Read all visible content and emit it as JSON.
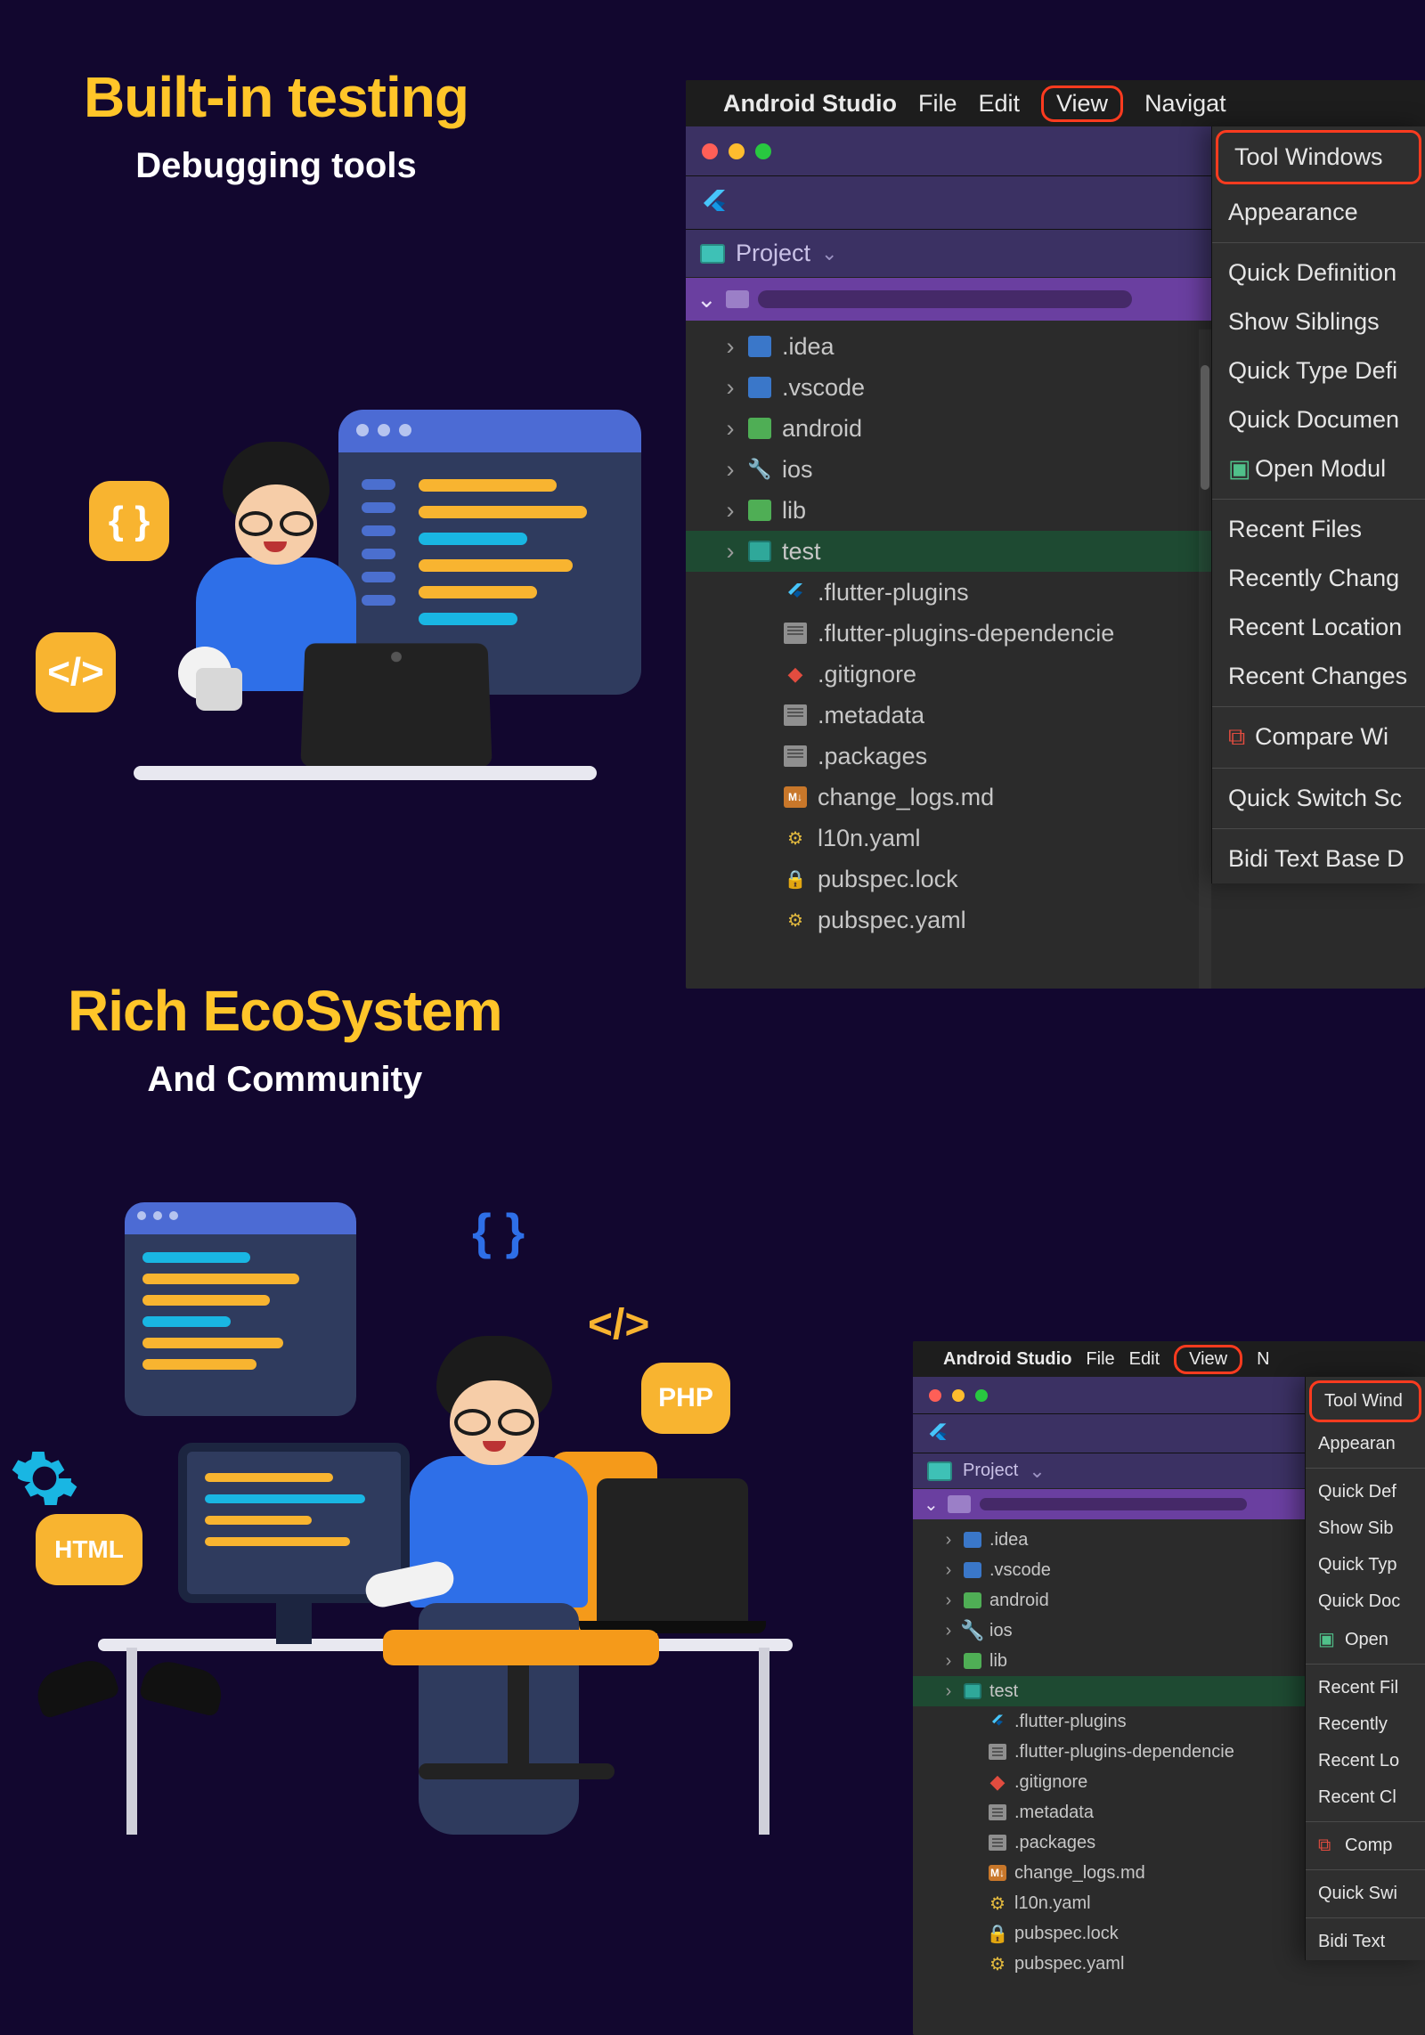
{
  "sections": {
    "builtIn": {
      "title": "Built-in testing",
      "subtitle": "Debugging tools"
    },
    "ecosystem": {
      "title": "Rich EcoSystem",
      "subtitle": "And Community"
    }
  },
  "illus2": {
    "chip_html": "HTML",
    "chip_php": "PHP",
    "braces": "{ }",
    "angles": "</>"
  },
  "illus1": {
    "chip1": "{ }",
    "chip2": "</>"
  },
  "studio": {
    "menubar": {
      "app": "Android Studio",
      "items": [
        "File",
        "Edit",
        "View",
        "Navigat",
        "N"
      ]
    },
    "project_label": "Project",
    "tree": [
      {
        "name": ".idea",
        "icon": "folder blue",
        "caret": true
      },
      {
        "name": ".vscode",
        "icon": "folder blue",
        "caret": true
      },
      {
        "name": "android",
        "icon": "folder green",
        "caret": true
      },
      {
        "name": "ios",
        "icon": "wrench",
        "caret": true
      },
      {
        "name": "lib",
        "icon": "folder green",
        "caret": true
      },
      {
        "name": "test",
        "icon": "folder teal",
        "caret": true,
        "selected": true
      },
      {
        "name": ".flutter-plugins",
        "icon": "flutter",
        "caret": false,
        "lvl": 2
      },
      {
        "name": ".flutter-plugins-dependencie",
        "icon": "file",
        "caret": false,
        "lvl": 2
      },
      {
        "name": ".gitignore",
        "icon": "git",
        "caret": false,
        "lvl": 2
      },
      {
        "name": ".metadata",
        "icon": "file",
        "caret": false,
        "lvl": 2
      },
      {
        "name": ".packages",
        "icon": "file",
        "caret": false,
        "lvl": 2
      },
      {
        "name": "change_logs.md",
        "icon": "md",
        "caret": false,
        "lvl": 2
      },
      {
        "name": "l10n.yaml",
        "icon": "yaml",
        "caret": false,
        "lvl": 2
      },
      {
        "name": "pubspec.lock",
        "icon": "lock",
        "caret": false,
        "lvl": 2
      },
      {
        "name": "pubspec.yaml",
        "icon": "yaml",
        "caret": false,
        "lvl": 2
      }
    ],
    "menu_big": [
      {
        "label": "Tool Windows",
        "hl": true
      },
      {
        "label": "Appearance"
      },
      {
        "sep": true
      },
      {
        "label": "Quick Definition"
      },
      {
        "label": "Show Siblings"
      },
      {
        "label": "Quick Type Defi"
      },
      {
        "label": "Quick Documen"
      },
      {
        "label": "Open Modul",
        "pre": "green"
      },
      {
        "sep": true
      },
      {
        "label": "Recent Files"
      },
      {
        "label": "Recently Chang"
      },
      {
        "label": "Recent Location"
      },
      {
        "label": "Recent Changes"
      },
      {
        "sep": true
      },
      {
        "label": "Compare Wi",
        "pre": "red"
      },
      {
        "sep": true
      },
      {
        "label": "Quick Switch Sc"
      },
      {
        "sep": true
      },
      {
        "label": "Bidi Text Base D"
      }
    ],
    "menu_small": [
      {
        "label": "Tool Wind",
        "hl": true
      },
      {
        "label": "Appearan"
      },
      {
        "sep": true
      },
      {
        "label": "Quick Def"
      },
      {
        "label": "Show Sib"
      },
      {
        "label": "Quick Typ"
      },
      {
        "label": "Quick Doc"
      },
      {
        "label": "Open",
        "pre": "green"
      },
      {
        "sep": true
      },
      {
        "label": "Recent Fil"
      },
      {
        "label": "Recently"
      },
      {
        "label": "Recent Lo"
      },
      {
        "label": "Recent Cl"
      },
      {
        "sep": true
      },
      {
        "label": "Comp",
        "pre": "red"
      },
      {
        "sep": true
      },
      {
        "label": "Quick Swi"
      },
      {
        "sep": true
      },
      {
        "label": "Bidi Text"
      }
    ]
  }
}
